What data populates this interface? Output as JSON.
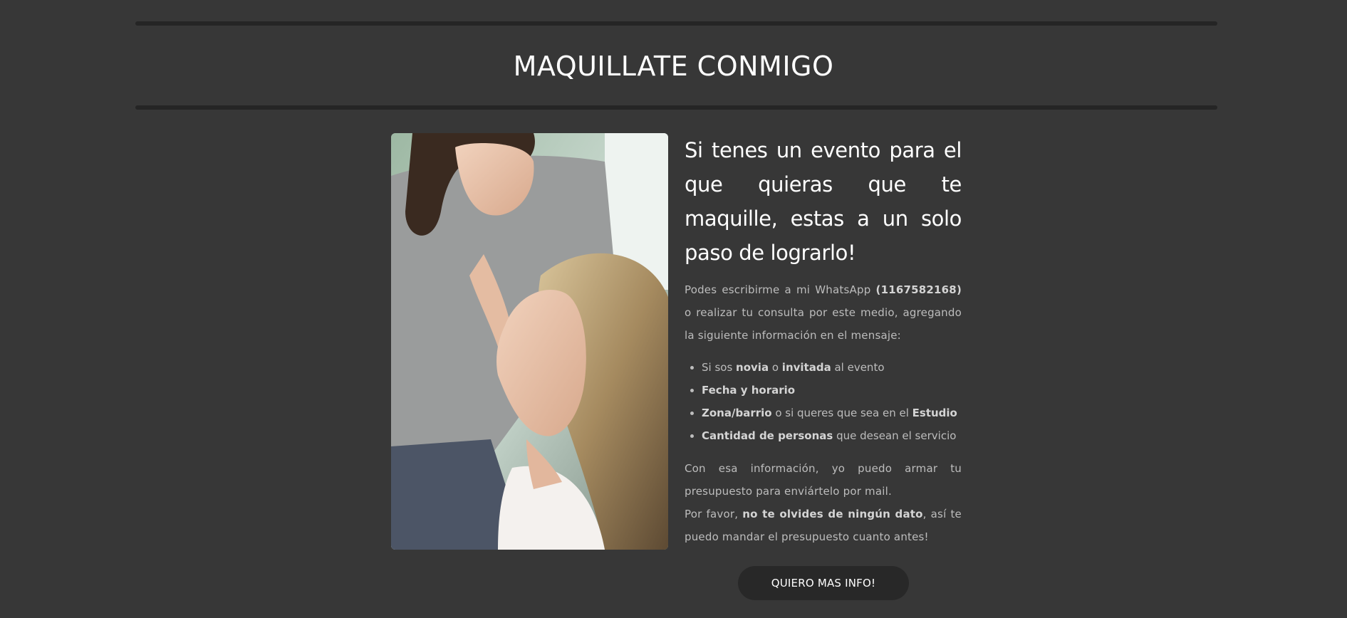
{
  "header": {
    "title": "MAQUILLATE CONMIGO"
  },
  "photo": {
    "alt": "Maquilladora maquillando a una novia"
  },
  "content": {
    "headline": "Si tenes un evento para el que quieras que te maquille, estas a un solo paso de lograrlo!",
    "intro": {
      "before": "Podes escribirme a mi WhatsApp ",
      "phone": "(1167582168)",
      "after": " o realizar tu consulta por este medio, agregando la siguiente información en el mensaje:"
    },
    "list": [
      {
        "t1": "Si sos ",
        "b1": "novia",
        "t2": " o ",
        "b2": "invitada",
        "t3": " al evento"
      },
      {
        "b1": "Fecha y horario"
      },
      {
        "b1": "Zona/barrio",
        "t2": " o si queres que sea en el ",
        "b2": "Estudio"
      },
      {
        "b1": "Cantidad de personas",
        "t2": " que desean el servicio"
      }
    ],
    "closing": {
      "line1": "Con esa información, yo puedo armar tu presupuesto para enviártelo por mail.",
      "line2_before": "Por favor, ",
      "line2_bold": "no te olvides de ningún dato",
      "line2_after": ", así te puedo mandar el presupuesto cuanto antes!"
    }
  },
  "cta": {
    "label": "QUIERO MAS INFO!"
  },
  "colors": {
    "background": "#373737",
    "rule": "#252525",
    "button": "#282828",
    "text": "#bdbdbd"
  }
}
